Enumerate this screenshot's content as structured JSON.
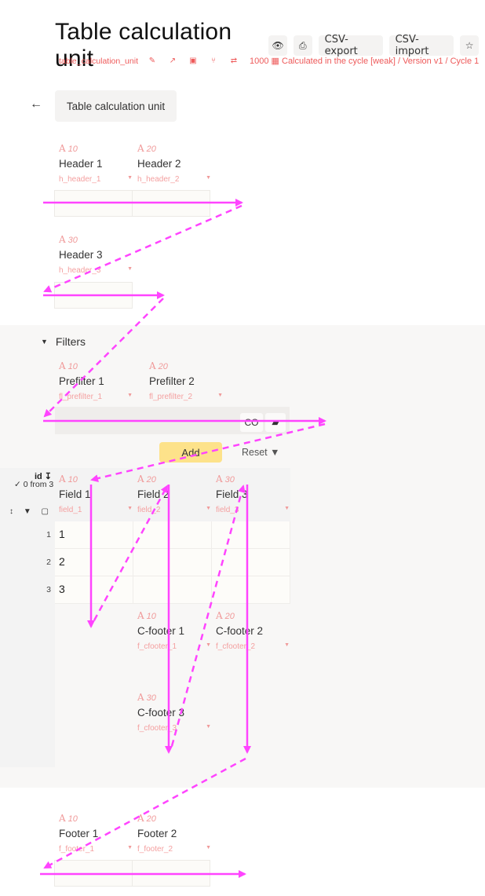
{
  "header": {
    "title": "Table calculation unit",
    "buttons": {
      "hide_icon": "eye-slash-icon",
      "print_icon": "printer-icon",
      "csv_export": "CSV-export",
      "csv_import": "CSV-import",
      "star_icon": "star-icon"
    },
    "subline": {
      "name": "table_calculation_unit",
      "icons": [
        "edit-icon",
        "external-link-icon",
        "image-icon",
        "fork-icon",
        "shuffle-icon"
      ],
      "number": "1000",
      "cycle_text": "Calculated in the cycle [weak] / Version v1 / Cycle 1"
    }
  },
  "breadcrumb": {
    "back_icon": "arrow-left-icon",
    "label": "Table calculation unit"
  },
  "headers": [
    {
      "order": "10",
      "label": "Header 1",
      "code": "h_header_1"
    },
    {
      "order": "20",
      "label": "Header 2",
      "code": "h_header_2"
    },
    {
      "order": "30",
      "label": "Header 3",
      "code": "h_header_3"
    }
  ],
  "filters": {
    "title": "Filters",
    "prefilters": [
      {
        "order": "10",
        "label": "Prefilter 1",
        "code": "fl_prefilter_1"
      },
      {
        "order": "20",
        "label": "Prefilter 2",
        "code": "fl_prefilter_2"
      }
    ],
    "link_button": "CO",
    "eraser_icon": "eraser-icon",
    "add_label": "Add",
    "reset_label": "Reset"
  },
  "table": {
    "id_header": "id",
    "selection": "✓ 0 from 3",
    "columns": [
      {
        "order": "10",
        "label": "Field 1",
        "code": "field_1"
      },
      {
        "order": "20",
        "label": "Field 2",
        "code": "field_2"
      },
      {
        "order": "30",
        "label": "Field 3",
        "code": "field_3"
      }
    ],
    "rows": [
      {
        "id": "1",
        "cells": [
          "1",
          "",
          ""
        ]
      },
      {
        "id": "2",
        "cells": [
          "2",
          "",
          ""
        ]
      },
      {
        "id": "3",
        "cells": [
          "3",
          "",
          ""
        ]
      }
    ],
    "column_footers": [
      {
        "order": "10",
        "label": "C-footer 1",
        "code": "f_cfooter_1"
      },
      {
        "order": "20",
        "label": "C-footer 2",
        "code": "f_cfooter_2"
      },
      {
        "order": "30",
        "label": "C-footer 3",
        "code": "f_cfooter_3"
      }
    ]
  },
  "footers": [
    {
      "order": "10",
      "label": "Footer 1",
      "code": "f_footer_1"
    },
    {
      "order": "20",
      "label": "Footer 2",
      "code": "f_footer_2"
    }
  ],
  "colors": {
    "accent": "#ee5a5a",
    "add_button": "#fde28a",
    "annotation": "#ff44ff"
  }
}
